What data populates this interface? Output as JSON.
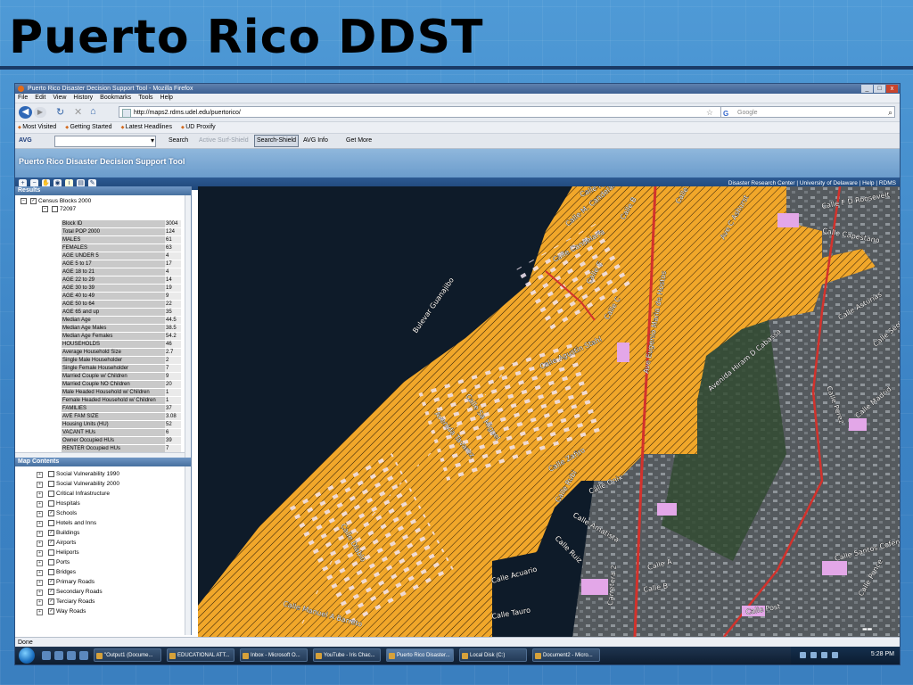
{
  "slide": {
    "title": "Puerto Rico DDST"
  },
  "browser": {
    "window_title": "Puerto Rico Disaster Decision Support Tool - Mozilla Firefox",
    "window_buttons": [
      "_",
      "□",
      "x"
    ],
    "menu": [
      "File",
      "Edit",
      "View",
      "History",
      "Bookmarks",
      "Tools",
      "Help"
    ],
    "url": "http://maps2.rdms.udel.edu/puertorico/",
    "search_placeholder": "Google",
    "bookmarks": [
      "Most Visited",
      "Getting Started",
      "Latest Headlines",
      "UD Proxify"
    ],
    "avg_toolbar": {
      "logo": "AVG",
      "search_label": "Search",
      "active_surf_shield": "Active Surf-Shield",
      "search_shield": "Search-Shield",
      "avg_info": "AVG Info",
      "get_more": "Get More"
    },
    "status": "Done"
  },
  "app": {
    "title": "Puerto Rico Disaster Decision Support Tool",
    "links": "Disaster Research Center | University of Delaware | Help | RDMS",
    "results": {
      "header": "Results",
      "layer": "Census Blocks 2000",
      "block": "72097",
      "attributes": [
        {
          "k": "Block ID",
          "v": "3004"
        },
        {
          "k": "Total POP 2000",
          "v": "124"
        },
        {
          "k": "MALES",
          "v": "61"
        },
        {
          "k": "FEMALES",
          "v": "63"
        },
        {
          "k": "AGE UNDER 5",
          "v": "4"
        },
        {
          "k": "AGE 5 to 17",
          "v": "17"
        },
        {
          "k": "AGE 18 to 21",
          "v": "4"
        },
        {
          "k": "AGE 22 to 29",
          "v": "14"
        },
        {
          "k": "AGE 30 to 39",
          "v": "19"
        },
        {
          "k": "AGE 40 to 49",
          "v": "9"
        },
        {
          "k": "AGE 50 to 64",
          "v": "22"
        },
        {
          "k": "AGE 65 and up",
          "v": "35"
        },
        {
          "k": "Median Age",
          "v": "44.5"
        },
        {
          "k": "Median Age Males",
          "v": "38.5"
        },
        {
          "k": "Median Age Females",
          "v": "54.2"
        },
        {
          "k": "HOUSEHOLDS",
          "v": "46"
        },
        {
          "k": "Average Household Size",
          "v": "2.7"
        },
        {
          "k": "Single Male Householder",
          "v": "2"
        },
        {
          "k": "Single Female Householder",
          "v": "7"
        },
        {
          "k": "Married Couple w/ Children",
          "v": "9"
        },
        {
          "k": "Married Couple NO Children",
          "v": "20"
        },
        {
          "k": "Male Headed Household w/ Children",
          "v": "1"
        },
        {
          "k": "Female Headed Household w/ Children",
          "v": "1"
        },
        {
          "k": "FAMILIES",
          "v": "37"
        },
        {
          "k": "AVE FAM SIZE",
          "v": "3.08"
        },
        {
          "k": "Housing Units (HU)",
          "v": "52"
        },
        {
          "k": "VACANT HUs",
          "v": "6"
        },
        {
          "k": "Owner Occupied HUs",
          "v": "39"
        },
        {
          "k": "RENTER Occupied HUs",
          "v": "7"
        }
      ]
    },
    "map_contents": {
      "header": "Map Contents",
      "layers": [
        {
          "label": "Social Vulnerability 1990",
          "checked": false
        },
        {
          "label": "Social Vulnerability 2000",
          "checked": false
        },
        {
          "label": "Critical Infrastructure",
          "checked": false
        },
        {
          "label": "Hospitals",
          "checked": false
        },
        {
          "label": "Schools",
          "checked": true
        },
        {
          "label": "Hotels and Inns",
          "checked": false
        },
        {
          "label": "Buildings",
          "checked": true
        },
        {
          "label": "Airports",
          "checked": true
        },
        {
          "label": "Heliports",
          "checked": false
        },
        {
          "label": "Ports",
          "checked": false
        },
        {
          "label": "Bridges",
          "checked": false
        },
        {
          "label": "Primary Roads",
          "checked": true
        },
        {
          "label": "Secondary Roads",
          "checked": true
        },
        {
          "label": "Terciary Roads",
          "checked": true
        },
        {
          "label": "Way Roads",
          "checked": true
        }
      ]
    },
    "map_labels": [
      "Calle Komaguera",
      "Calle M. Candelaria",
      "Calle B",
      "Calle D",
      "Calle Capestano",
      "Calle Candelaria",
      "Calle E",
      "Calle C",
      "Ave Eugenio Maria de Hostos",
      "Bulevar Guanajibo",
      "Calle Agustin Stahl",
      "Avenida Tavarez",
      "Calle Sa Miguel",
      "Calle Zafiro",
      "Calle Onix",
      "Calle Rubi",
      "Calle Amatista",
      "Calle Ruiz",
      "Calle Diablo",
      "Calle Manuel A Barreto",
      "Carretera 2",
      "Calle A",
      "Calle B",
      "Calle Acuario",
      "Calle Tauro",
      "Calle Post",
      "Calle Santos Cofen",
      "Avenida Hiram D Cabassa",
      "Calle Asturias",
      "Calle Segovia",
      "Calle Madrid",
      "Calle F D Roosevelt",
      "Ave C Ashurst",
      "Calle Perez",
      "Calle Ponce"
    ],
    "colors": {
      "hazard_fill": "#f1a72a",
      "primary_road": "#d3322c",
      "ocean": "#0e1b29",
      "building": "#e3a7e8"
    }
  },
  "taskbar": {
    "tasks": [
      "\"Output1 (Docume...",
      "EDUCATIONAL ATT...",
      "Inbox - Microsoft O...",
      "YouTube - Iris Chac...",
      "Puerto Rico Disaster...",
      "Local Disk (C:)",
      "Document2 - Micro..."
    ],
    "clock": "5:28 PM"
  }
}
